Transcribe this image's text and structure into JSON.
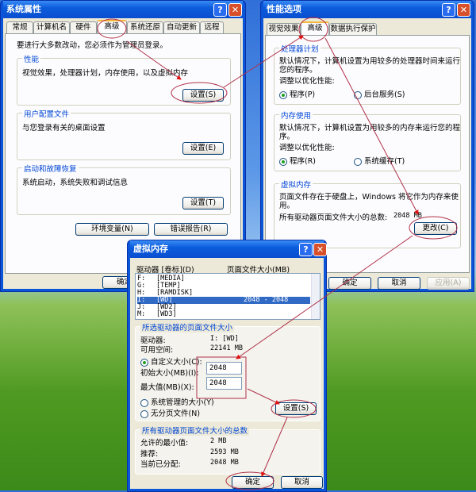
{
  "sys": {
    "title": "系统属性",
    "tabs": [
      "常规",
      "计算机名",
      "硬件",
      "高级",
      "系统还原",
      "自动更新",
      "远程"
    ],
    "note": "要进行大多数改动，您必须作为管理员登录。",
    "perf": {
      "header": "性能",
      "text": "视觉效果，处理器计划，内存使用，以及虚拟内存",
      "btn": "设置(S)"
    },
    "profile": {
      "header": "用户配置文件",
      "text": "与您登录有关的桌面设置",
      "btn": "设置(E)"
    },
    "startup": {
      "header": "启动和故障恢复",
      "text": "系统启动，系统失败和调试信息",
      "btn": "设置(T)"
    },
    "env_btn": "环境变量(N)",
    "err_btn": "错误报告(R)",
    "ok": "确定"
  },
  "perfopt": {
    "title": "性能选项",
    "tabs": [
      "视觉效果",
      "高级",
      "数据执行保护"
    ],
    "cpu": {
      "header": "处理器计划",
      "text1": "默认情况下，计算机设置为用较多的处理器时间来运行",
      "text2": "您的程序。",
      "adjust": "调整以优化性能:",
      "r1": "程序(P)",
      "r2": "后台服务(S)"
    },
    "mem": {
      "header": "内存使用",
      "text1": "默认情况下，计算机设置为用较多的内存来运行您的程",
      "text2": "序。",
      "adjust": "调整以优化性能:",
      "r1": "程序(R)",
      "r2": "系统缓存(T)"
    },
    "vm": {
      "header": "虚拟内存",
      "text1": "页面文件存在于硬盘上，Windows 将它作为内存来使",
      "text2": "用。",
      "total_label": "所有驱动器页面文件大小的总数:",
      "total": "2048 MB",
      "btn": "更改(C)"
    },
    "ok": "确定",
    "cancel": "取消",
    "apply": "应用(A)"
  },
  "vm": {
    "title": "虚拟内存",
    "col1": "驱动器 [卷标](D)",
    "col2": "页面文件大小(MB)",
    "drives": [
      {
        "d": "F:",
        "l": "[MEDIA]",
        "s": ""
      },
      {
        "d": "G:",
        "l": "[TEMP]",
        "s": ""
      },
      {
        "d": "H:",
        "l": "[RAMDISK]",
        "s": ""
      },
      {
        "d": "I:",
        "l": "[WD]",
        "s": "2048 - 2048"
      },
      {
        "d": "J:",
        "l": "[WD2]",
        "s": ""
      },
      {
        "d": "M:",
        "l": "[WD3]",
        "s": ""
      }
    ],
    "sel": {
      "header": "所选驱动器的页面文件大小",
      "drive_label": "驱动器:",
      "drive": "I:  [WD]",
      "free_label": "可用空间:",
      "free": "22141 MB",
      "custom": "自定义大小(C):",
      "initial_label": "初始大小(MB)(I):",
      "initial": "2048",
      "max_label": "最大值(MB)(X):",
      "max": "2048",
      "system": "系统管理的大小(Y)",
      "none": "无分页文件(N)",
      "set": "设置(S)"
    },
    "total": {
      "header": "所有驱动器页面文件大小的总数",
      "min_label": "允许的最小值:",
      "min": "2 MB",
      "rec_label": "推荐:",
      "rec": "2593 MB",
      "cur_label": "当前已分配:",
      "cur": "2048 MB"
    },
    "ok": "确定",
    "cancel": "取消"
  },
  "help": "?",
  "close": "✕"
}
